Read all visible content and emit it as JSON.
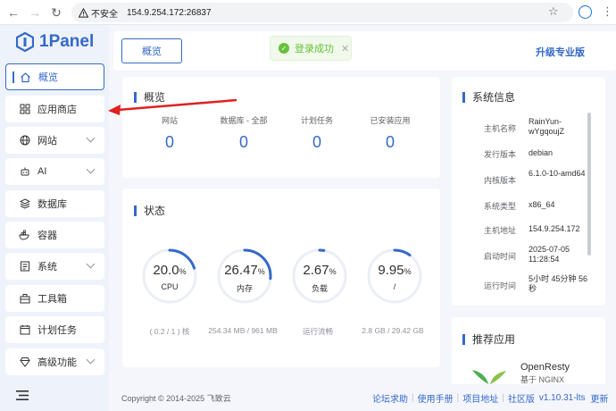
{
  "browser": {
    "insecure_label": "不安全",
    "url": "154.9.254.172:26837"
  },
  "sidebar": {
    "logo": "1Panel",
    "items": [
      {
        "label": "概览",
        "icon": "home-icon",
        "active": true
      },
      {
        "label": "应用商店",
        "icon": "apps-grid-icon"
      },
      {
        "label": "网站",
        "icon": "globe-icon",
        "has_children": true
      },
      {
        "label": "AI",
        "icon": "robot-icon",
        "has_children": true
      },
      {
        "label": "数据库",
        "icon": "database-layers-icon"
      },
      {
        "label": "容器",
        "icon": "docker-whale-icon"
      },
      {
        "label": "系统",
        "icon": "system-icon",
        "has_children": true
      },
      {
        "label": "工具箱",
        "icon": "toolbox-icon"
      },
      {
        "label": "计划任务",
        "icon": "calendar-task-icon"
      },
      {
        "label": "高级功能",
        "icon": "diamond-icon",
        "has_children": true
      }
    ]
  },
  "header": {
    "tab_label": "概览",
    "toast": "登录成功",
    "upgrade_label": "升级专业版"
  },
  "overview": {
    "title": "概览",
    "stats": [
      {
        "label": "网站",
        "value": "0"
      },
      {
        "label": "数据库 - 全部",
        "value": "0"
      },
      {
        "label": "计划任务",
        "value": "0"
      },
      {
        "label": "已安装应用",
        "value": "0"
      }
    ]
  },
  "status": {
    "title": "状态",
    "gauges": [
      {
        "value": "20.0",
        "unit": "%",
        "name": "CPU",
        "percent": 20.0,
        "sub": "( 0.2 / 1 ) 核"
      },
      {
        "value": "26.47",
        "unit": "%",
        "name": "内存",
        "percent": 26.47,
        "sub": "254.34 MB / 961 MB"
      },
      {
        "value": "2.67",
        "unit": "%",
        "name": "负载",
        "percent": 2.67,
        "sub": "运行流畅"
      },
      {
        "value": "9.95",
        "unit": "%",
        "name": "/",
        "percent": 9.95,
        "sub": "2.8 GB / 29.42 GB"
      }
    ]
  },
  "sysinfo": {
    "title": "系统信息",
    "rows": [
      {
        "k": "主机名称",
        "v": "RainYun-wYgqoujZ"
      },
      {
        "k": "发行版本",
        "v": "debian"
      },
      {
        "k": "内核版本",
        "v": "6.1.0-10-amd64"
      },
      {
        "k": "系统类型",
        "v": "x86_64"
      },
      {
        "k": "主机地址",
        "v": "154.9.254.172"
      },
      {
        "k": "启动时间",
        "v": "2025-07-05 11:28:54"
      },
      {
        "k": "运行时间",
        "v": "5小时 45分钟 56秒"
      }
    ]
  },
  "recommend": {
    "title": "推荐应用",
    "app_name": "OpenResty",
    "app_desc": "基于 NGINX"
  },
  "footer": {
    "copyright": "Copyright © 2014-2025 飞致云",
    "links": [
      "论坛求助",
      "使用手册",
      "项目地址",
      "社区版"
    ],
    "version": "v1.10.31-lts",
    "update": "更新"
  },
  "colors": {
    "accent": "#3569c9",
    "success": "#67c23a",
    "arrow": "#e02020"
  }
}
